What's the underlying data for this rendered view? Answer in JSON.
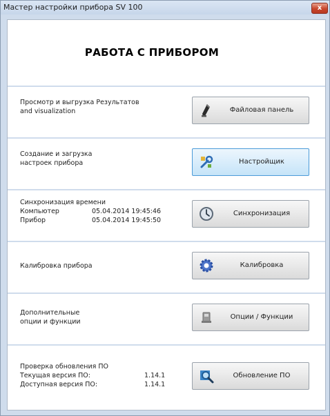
{
  "window": {
    "title": "Мастер настройки прибора SV 100",
    "close_label": "x"
  },
  "header": {
    "title": "РАБОТА С ПРИБОРОМ"
  },
  "sections": [
    {
      "lines": [
        "Просмотр и выгрузка Результатов",
        "and visualization"
      ],
      "button": {
        "label": "Файловая панель",
        "icon": "pen-icon"
      }
    },
    {
      "lines": [
        "Создание и загрузка",
        "настроек прибора"
      ],
      "button": {
        "label": "Настройщик",
        "icon": "wrench-icon",
        "state": "focused"
      }
    },
    {
      "title": "Синхронизация времени",
      "rows": [
        {
          "label": "Компьютер",
          "value": "05.04.2014 19:45:46"
        },
        {
          "label": "Прибор",
          "value": "05.04.2014 19:45:50"
        }
      ],
      "button": {
        "label": "Синхронизация",
        "icon": "clock-icon"
      }
    },
    {
      "lines": [
        "Калибровка прибора"
      ],
      "button": {
        "label": "Калибровка",
        "icon": "gear-icon"
      }
    },
    {
      "lines": [
        "Дополнительные",
        "опции и функции"
      ],
      "button": {
        "label": "Опции / Функции",
        "icon": "device-icon"
      }
    },
    {
      "title": "Проверка обновления ПО",
      "rows": [
        {
          "label": "Текущая версия ПО:",
          "value": "1.14.1"
        },
        {
          "label": "Доступная версия ПО:",
          "value": "1.14.1"
        }
      ],
      "button": {
        "label": "Обновление ПО",
        "icon": "magnifier-icon"
      }
    }
  ],
  "colors": {
    "window_bg": "#cfdcec",
    "panel_bg": "#ffffff",
    "focus_border": "#4a9ad8",
    "close_red": "#c8462c"
  }
}
